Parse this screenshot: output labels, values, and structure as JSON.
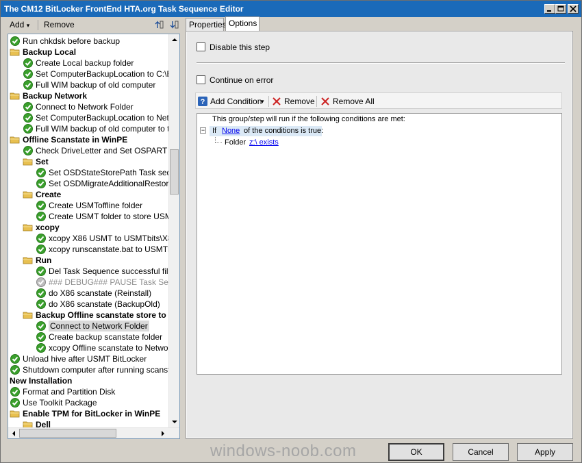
{
  "window": {
    "title": "The CM12 BitLocker FrontEnd HTA.org Task Sequence Editor",
    "controls": [
      "_",
      "□",
      "X"
    ]
  },
  "left_toolbar": {
    "add_label": "Add",
    "add_arrow": "▾",
    "remove_label": "Remove",
    "move_up_icon": "move-up-icon",
    "move_down_icon": "move-down-icon"
  },
  "tree": {
    "items": [
      {
        "label": "Run chkdsk before backup",
        "type": "step",
        "level": 0
      },
      {
        "label": "Backup Local",
        "type": "group",
        "level": 0
      },
      {
        "label": "Create Local backup folder",
        "type": "step",
        "level": 1
      },
      {
        "label": "Set ComputerBackupLocation to C:\\Back",
        "type": "step",
        "level": 1
      },
      {
        "label": "Full WIM backup of old computer",
        "type": "step",
        "level": 1
      },
      {
        "label": "Backup Network",
        "type": "group",
        "level": 0
      },
      {
        "label": "Connect to Network Folder",
        "type": "step",
        "level": 1
      },
      {
        "label": "Set ComputerBackupLocation to Network",
        "type": "step",
        "level": 1
      },
      {
        "label": "Full WIM backup of old computer to the N",
        "type": "step",
        "level": 1
      },
      {
        "label": "Offline Scanstate in WinPE",
        "type": "group",
        "level": 0
      },
      {
        "label": "Check DriveLetter and Set OSPART vari",
        "type": "step",
        "level": 1
      },
      {
        "label": "Set",
        "type": "group",
        "level": 1
      },
      {
        "label": "Set OSDStateStorePath Task seque",
        "type": "step",
        "level": 2
      },
      {
        "label": "Set OSDMigrateAdditionalRestoreOp",
        "type": "step",
        "level": 2
      },
      {
        "label": "Create",
        "type": "group",
        "level": 1
      },
      {
        "label": "Create USMToffline folder",
        "type": "step",
        "level": 2
      },
      {
        "label": "Create USMT folder to store USMT p",
        "type": "step",
        "level": 2
      },
      {
        "label": "xcopy",
        "type": "group",
        "level": 1
      },
      {
        "label": "xcopy X86 USMT to USMTbits\\X86",
        "type": "step",
        "level": 2
      },
      {
        "label": "xcopy runscanstate.bat to USMTbits",
        "type": "step",
        "level": 2
      },
      {
        "label": "Run",
        "type": "group",
        "level": 1
      },
      {
        "label": "Del Task Sequence successful file",
        "type": "step",
        "level": 2
      },
      {
        "label": "### DEBUG### PAUSE Task Sequ",
        "type": "disabled",
        "level": 2
      },
      {
        "label": "do X86 scanstate (Reinstall)",
        "type": "step",
        "level": 2
      },
      {
        "label": "do X86 scanstate (BackupOld)",
        "type": "step",
        "level": 2
      },
      {
        "label": "Backup Offline scanstate store to",
        "type": "group",
        "level": 1
      },
      {
        "label": "Connect to Network Folder",
        "type": "step",
        "level": 2,
        "selected": true
      },
      {
        "label": "Create backup scanstate folder",
        "type": "step",
        "level": 2
      },
      {
        "label": "xcopy Offline scanstate to Network",
        "type": "step",
        "level": 2
      },
      {
        "label": "Unload hive after USMT BitLocker",
        "type": "step",
        "level": 0
      },
      {
        "label": "Shutdown computer after running scanstate",
        "type": "step",
        "level": 0
      },
      {
        "label": "New Installation",
        "type": "plain-group",
        "level": 0
      },
      {
        "label": "Format and Partition Disk",
        "type": "step",
        "level": 0
      },
      {
        "label": "Use Toolkit Package",
        "type": "step",
        "level": 0
      },
      {
        "label": "Enable TPM for BitLocker in WinPE",
        "type": "group",
        "level": 0
      },
      {
        "label": "Dell",
        "type": "group",
        "level": 1
      }
    ]
  },
  "tabs": [
    {
      "label": "Properties",
      "active": false
    },
    {
      "label": "Options",
      "active": true
    }
  ],
  "options": {
    "disable_step_label": "Disable this step",
    "disable_step_checked": false,
    "continue_on_error_label": "Continue on error",
    "continue_on_error_checked": false
  },
  "condition_toolbar": {
    "add_condition_label": "Add Condition",
    "add_condition_arrow": "▾",
    "remove_label": "Remove",
    "remove_all_label": "Remove All"
  },
  "conditions": {
    "intro": "This group/step will run if the following conditions are met:",
    "expander": "−",
    "if_prefix": "If",
    "if_operator": "None",
    "if_suffix": "of the conditions is true:",
    "folder_prefix": "Folder",
    "folder_value": "z:\\ exists"
  },
  "footer": {
    "watermark": "windows-noob.com",
    "ok_label": "OK",
    "cancel_label": "Cancel",
    "apply_label": "Apply"
  },
  "colors": {
    "title_bar": "#1a6ab9",
    "step_check": "#3aa02c",
    "folder": "#e8c050",
    "remove_x": "#cc2222",
    "link": "#0000ee",
    "help_icon": "#2a63b8"
  }
}
